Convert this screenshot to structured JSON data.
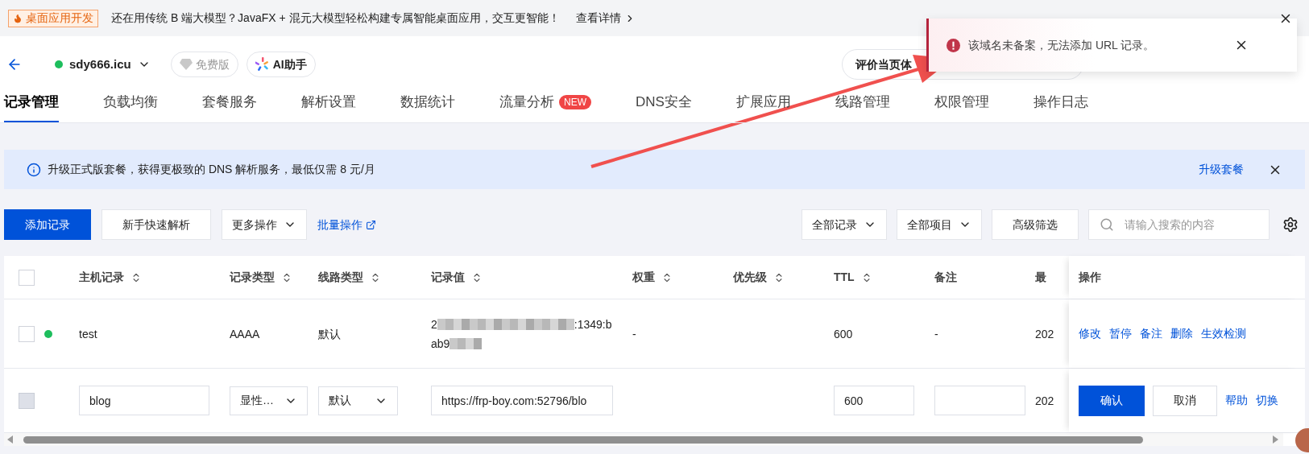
{
  "promo_bar": {
    "badge": "桌面应用开发",
    "text": "还在用传统 B 端大模型？JavaFX + 混元大模型轻松构建专属智能桌面应用，交互更智能！",
    "link": "查看详情"
  },
  "header": {
    "domain": "sdy666.icu",
    "plan": "免费版",
    "assistant": "AI助手",
    "feedback": "评价当页体"
  },
  "toast": {
    "message": "该域名未备案，无法添加 URL 记录。"
  },
  "tabs": [
    {
      "label": "记录管理",
      "selected": true
    },
    {
      "label": "负载均衡",
      "selected": false
    },
    {
      "label": "套餐服务",
      "selected": false
    },
    {
      "label": "解析设置",
      "selected": false
    },
    {
      "label": "数据统计",
      "selected": false
    },
    {
      "label": "流量分析",
      "selected": false,
      "badge": "NEW"
    },
    {
      "label": "DNS安全",
      "selected": false
    },
    {
      "label": "扩展应用",
      "selected": false
    },
    {
      "label": "线路管理",
      "selected": false
    },
    {
      "label": "权限管理",
      "selected": false
    },
    {
      "label": "操作日志",
      "selected": false
    }
  ],
  "banner": {
    "text": "升级正式版套餐，获得更极致的 DNS 解析服务，最低仅需 8 元/月",
    "link": "升级套餐"
  },
  "toolbar": {
    "left": [
      {
        "label": "添加记录",
        "kind": "primary"
      },
      {
        "label": "新手快速解析",
        "kind": "default"
      },
      {
        "label": "更多操作",
        "kind": "dropdown"
      },
      {
        "label": "批量操作",
        "kind": "external_link"
      }
    ],
    "right": [
      {
        "label": "全部记录",
        "kind": "dropdown"
      },
      {
        "label": "全部项目",
        "kind": "dropdown"
      },
      {
        "label": "高级筛选",
        "kind": "default"
      }
    ],
    "search": {
      "placeholder": "请输入搜索的内容"
    }
  },
  "table": {
    "header_checked": false,
    "columns": [
      {
        "label": "主机记录",
        "sortable": true
      },
      {
        "label": "记录类型",
        "sortable": true
      },
      {
        "label": "线路类型",
        "sortable": true
      },
      {
        "label": "记录值",
        "sortable": true
      },
      {
        "label": "权重",
        "sortable": true
      },
      {
        "label": "优先级",
        "sortable": true
      },
      {
        "label": "TTL",
        "sortable": true
      },
      {
        "label": "备注",
        "sortable": false
      },
      {
        "label": "最",
        "sortable": false
      }
    ],
    "action_column": "操作",
    "rows": [
      {
        "kind": "record",
        "checked": false,
        "disabled": false,
        "color": "#1ebe5d",
        "host": "test",
        "type": "AAAA",
        "line": "默认",
        "value_parts": [
          "2",
          ":1349:b",
          "ab9"
        ],
        "weight": "-",
        "ttl": "600",
        "remark": "-",
        "last": "202",
        "actions": [
          "修改",
          "暂停",
          "备注",
          "删除",
          "生效检测"
        ]
      },
      {
        "kind": "editing",
        "checked": false,
        "disabled": true,
        "host": "blog",
        "type": "显性…",
        "line": "默认",
        "value": "https://frp-boy.com:52796/blo",
        "ttl": "600",
        "last": "202",
        "confirm": "确认",
        "cancel": "取消",
        "links": [
          "帮助",
          "切换"
        ]
      }
    ]
  }
}
